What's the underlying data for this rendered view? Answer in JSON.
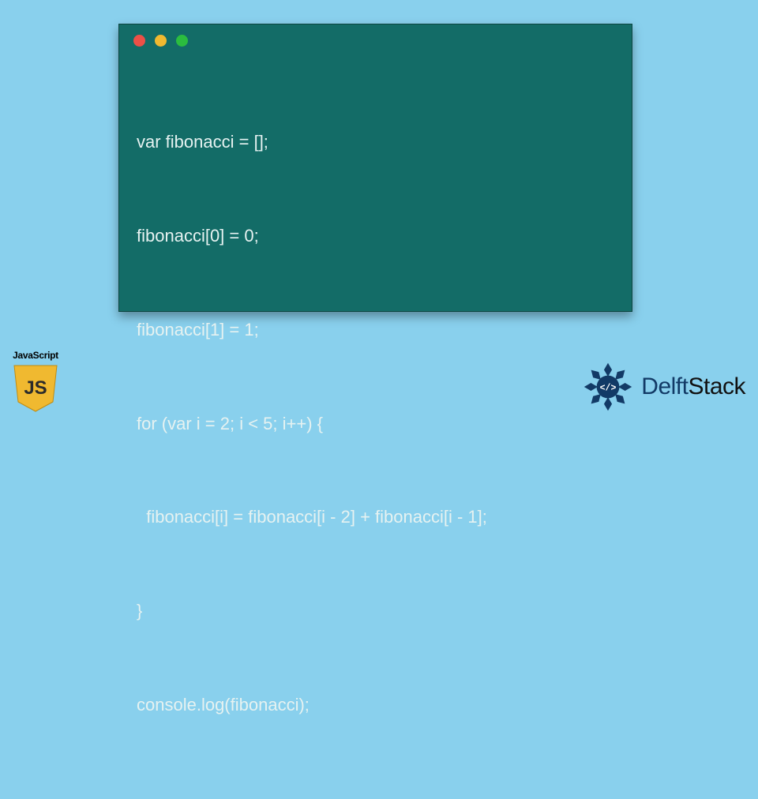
{
  "code": {
    "lines": [
      "var fibonacci = [];",
      "fibonacci[0] = 0;",
      "fibonacci[1] = 1;",
      "for (var i = 2; i < 5; i++) {",
      "  fibonacci[i] = fibonacci[i - 2] + fibonacci[i - 1];",
      "}",
      "console.log(fibonacci);"
    ]
  },
  "js_badge": {
    "label": "JavaScript",
    "shield_text": "JS"
  },
  "brand": {
    "name_part1": "Delft",
    "name_part2": "Stack",
    "logo_glyph": "</>"
  },
  "colors": {
    "page_bg": "#89d0ed",
    "card_bg": "#136c67",
    "dot_red": "#ec5047",
    "dot_yellow": "#f0b930",
    "dot_green": "#2bbd3f",
    "js_yellow": "#f0b930",
    "delft_blue": "#123a66"
  }
}
